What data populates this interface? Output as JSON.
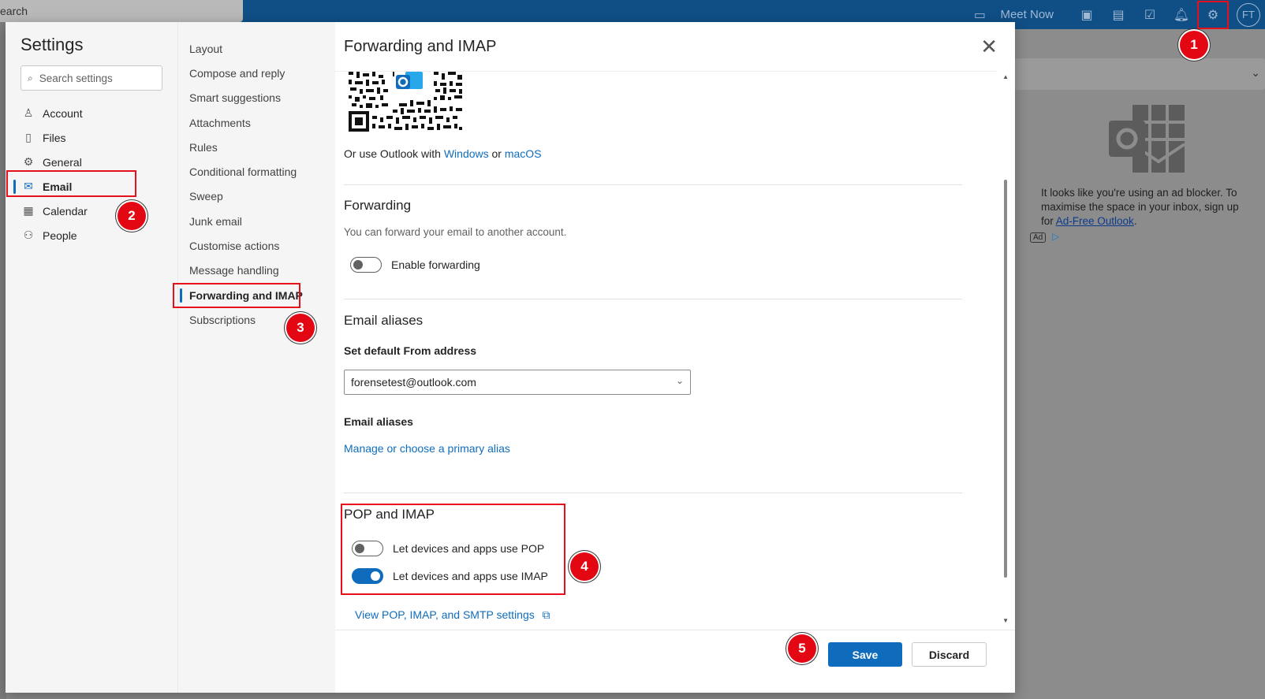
{
  "topbar": {
    "search_fragment": "earch",
    "meet_now": "Meet Now",
    "avatar_initials": "FT"
  },
  "ad": {
    "text_before": "It looks like you're using an ad blocker. To maximise the space in your inbox, sign up for ",
    "link": "Ad-Free Outlook",
    "text_after": ".",
    "badge": "Ad"
  },
  "settings": {
    "title": "Settings",
    "search_placeholder": "Search settings",
    "categories": [
      {
        "label": "Account",
        "icon": "person-icon"
      },
      {
        "label": "Files",
        "icon": "file-icon"
      },
      {
        "label": "General",
        "icon": "gear-icon"
      },
      {
        "label": "Email",
        "icon": "mail-icon",
        "active": true
      },
      {
        "label": "Calendar",
        "icon": "calendar-icon"
      },
      {
        "label": "People",
        "icon": "people-icon"
      }
    ],
    "subcategories": [
      {
        "label": "Layout"
      },
      {
        "label": "Compose and reply"
      },
      {
        "label": "Smart suggestions"
      },
      {
        "label": "Attachments"
      },
      {
        "label": "Rules"
      },
      {
        "label": "Conditional formatting"
      },
      {
        "label": "Sweep"
      },
      {
        "label": "Junk email"
      },
      {
        "label": "Customise actions"
      },
      {
        "label": "Message handling"
      },
      {
        "label": "Forwarding and IMAP",
        "active": true
      },
      {
        "label": "Subscriptions"
      }
    ]
  },
  "content": {
    "title": "Forwarding and IMAP",
    "or_use_prefix": "Or use Outlook with ",
    "windows_link": "Windows",
    "or_word": " or ",
    "macos_link": "macOS",
    "forwarding": {
      "title": "Forwarding",
      "subtitle": "You can forward your email to another account.",
      "toggle_label": "Enable forwarding",
      "enabled": false
    },
    "aliases": {
      "title": "Email aliases",
      "default_from_label": "Set default From address",
      "default_from_value": "forensetest@outlook.com",
      "aliases_label": "Email aliases",
      "manage_link": "Manage or choose a primary alias"
    },
    "pop_imap": {
      "title": "POP and IMAP",
      "pop_label": "Let devices and apps use POP",
      "pop_enabled": false,
      "imap_label": "Let devices and apps use IMAP",
      "imap_enabled": true,
      "view_settings_link": "View POP, IMAP, and SMTP settings"
    },
    "footer": {
      "save": "Save",
      "discard": "Discard"
    }
  },
  "annotations": [
    "1",
    "2",
    "3",
    "4",
    "5"
  ],
  "colors": {
    "accent": "#0f6cbd",
    "highlight": "#e5101a",
    "topbar": "#0f4f86"
  }
}
